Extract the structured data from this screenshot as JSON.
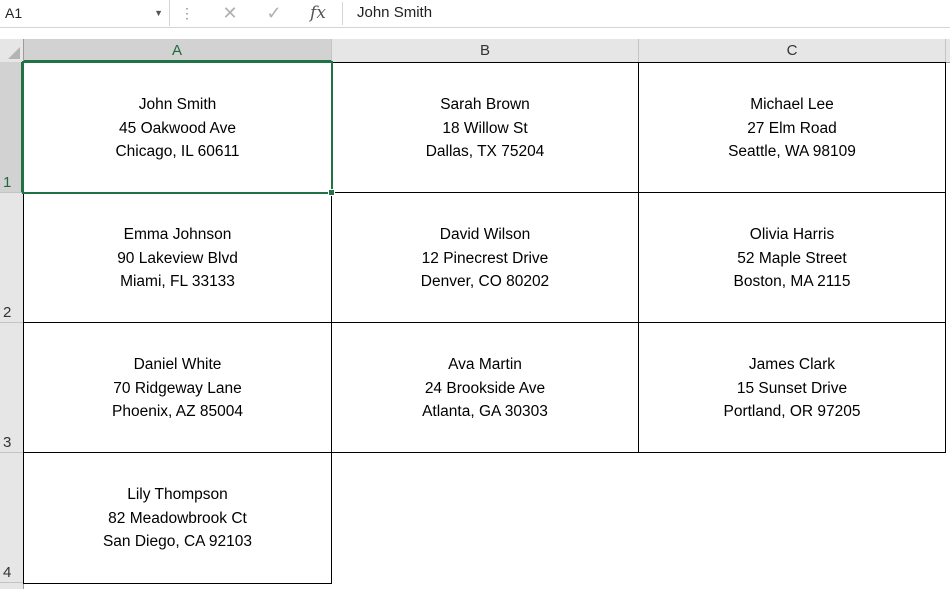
{
  "formula_bar": {
    "name_box": "A1",
    "formula": "John Smith"
  },
  "columns": [
    "A",
    "B",
    "C"
  ],
  "rows": [
    "1",
    "2",
    "3",
    "4"
  ],
  "cells": [
    [
      {
        "lines": [
          "John Smith",
          "45 Oakwood Ave",
          "Chicago, IL 60611"
        ]
      },
      {
        "lines": [
          "Sarah Brown",
          "18 Willow St",
          "Dallas, TX 75204"
        ]
      },
      {
        "lines": [
          "Michael Lee",
          "27 Elm Road",
          "Seattle, WA 98109"
        ]
      }
    ],
    [
      {
        "lines": [
          "Emma Johnson",
          "90 Lakeview Blvd",
          "Miami, FL 33133"
        ]
      },
      {
        "lines": [
          "David Wilson",
          "12 Pinecrest Drive",
          "Denver, CO 80202"
        ]
      },
      {
        "lines": [
          "Olivia Harris",
          "52 Maple Street",
          "Boston, MA 2115"
        ]
      }
    ],
    [
      {
        "lines": [
          "Daniel White",
          "70 Ridgeway Lane",
          "Phoenix, AZ 85004"
        ]
      },
      {
        "lines": [
          "Ava Martin",
          "24 Brookside Ave",
          "Atlanta, GA 30303"
        ]
      },
      {
        "lines": [
          "James Clark",
          "15 Sunset Drive",
          "Portland, OR 97205"
        ]
      }
    ],
    [
      {
        "lines": [
          "Lily Thompson",
          "82 Meadowbrook Ct",
          "San Diego, CA 92103"
        ]
      }
    ]
  ],
  "colors": {
    "selection": "#217346",
    "header_bg": "#e6e6e6"
  }
}
